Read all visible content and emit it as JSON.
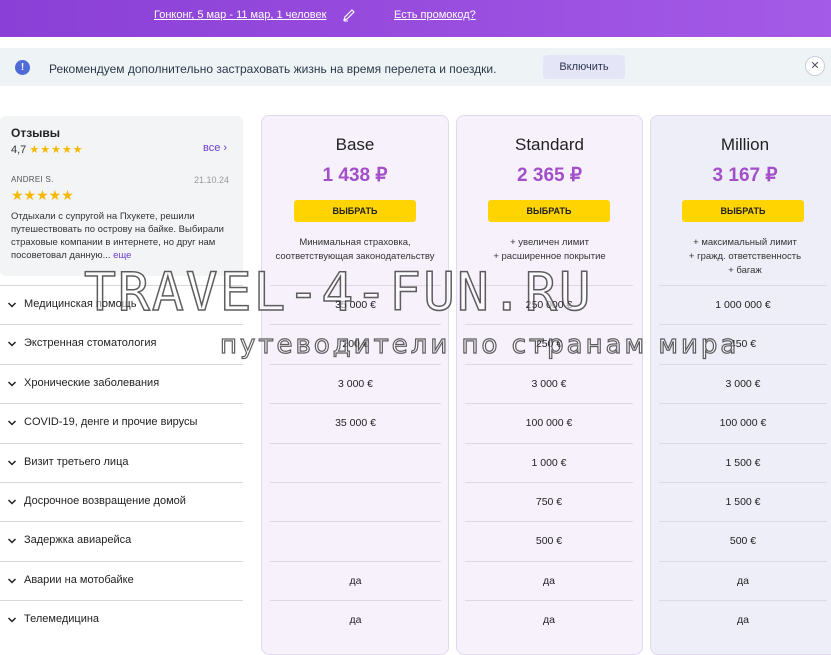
{
  "topbar": {
    "route": "Гонконг, 5 мар - 11 мар, 1 человек",
    "promo": "Есть промокод?"
  },
  "notice": {
    "text": "Рекомендуем дополнительно застраховать жизнь на время перелета и поездки.",
    "enable_button": "Включить"
  },
  "reviews": {
    "title": "Отзывы",
    "rating": "4,7",
    "all_link": "все",
    "review": {
      "author": "ANDREI S.",
      "date": "21.10.24",
      "text": "Отдыхали с супругой на Пхукете, решили путешествовать по острову на байке. Выбирали страховые компании в интернете, но друг нам посоветовал данную...",
      "more": "еще"
    }
  },
  "plans": [
    {
      "name": "Base",
      "price": "1 438 ₽",
      "button": "ВЫБРАТЬ",
      "desc": "Минимальная страховка, соответствующая законодательству"
    },
    {
      "name": "Standard",
      "price": "2 365 ₽",
      "button": "ВЫБРАТЬ",
      "desc": "+ увеличен лимит\n+ расширенное покрытие"
    },
    {
      "name": "Million",
      "price": "3 167 ₽",
      "button": "ВЫБРАТЬ",
      "desc": "+ максимальный лимит\n+ гражд. ответственность\n+ багаж"
    }
  ],
  "coverage": [
    {
      "label": "Медицинская помощь",
      "values": [
        "35 000 €",
        "250 000 €",
        "1 000 000 €"
      ]
    },
    {
      "label": "Экстренная стоматология",
      "values": [
        "200 €",
        "250 €",
        "450 €"
      ]
    },
    {
      "label": "Хронические заболевания",
      "values": [
        "3 000 €",
        "3 000 €",
        "3 000 €"
      ]
    },
    {
      "label": "COVID-19, денге и прочие вирусы",
      "values": [
        "35 000 €",
        "100 000 €",
        "100 000 €"
      ]
    },
    {
      "label": "Визит третьего лица",
      "values": [
        "",
        "1 000 €",
        "1 500 €"
      ]
    },
    {
      "label": "Досрочное возвращение домой",
      "values": [
        "",
        "750 €",
        "1 500 €"
      ]
    },
    {
      "label": "Задержка авиарейса",
      "values": [
        "",
        "500 €",
        "500 €"
      ]
    },
    {
      "label": "Аварии на мотобайке",
      "values": [
        "да",
        "да",
        "да"
      ]
    },
    {
      "label": "Телемедицина",
      "values": [
        "да",
        "да",
        "да"
      ]
    }
  ],
  "watermark": {
    "line1": "TRAVEL-4-FUN.RU",
    "line2": "путеводители по странам мира"
  },
  "colors": {
    "accent_purple": "#9b4fe0",
    "price": "#a24fc8",
    "button_yellow": "#ffd400",
    "star": "#f6b800"
  }
}
